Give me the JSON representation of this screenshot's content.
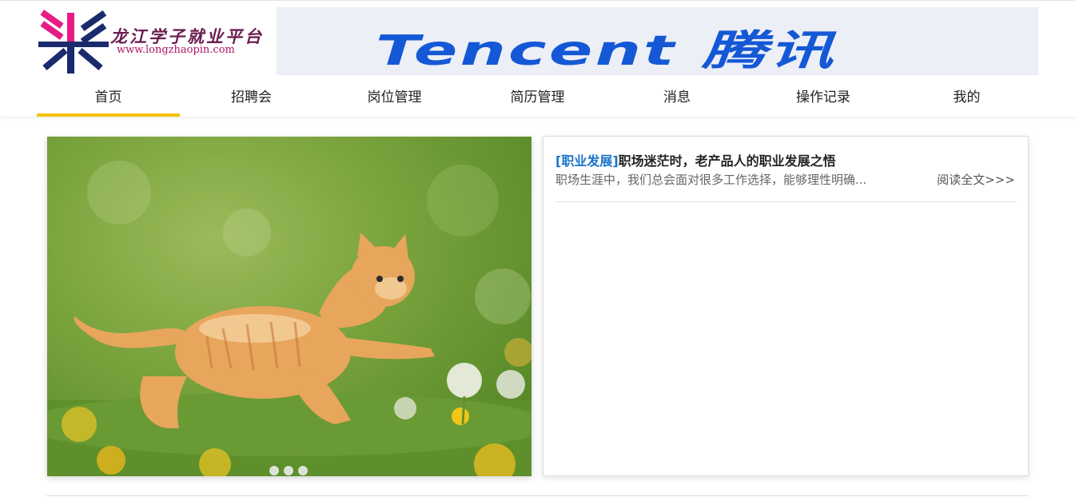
{
  "header": {
    "logo": {
      "title": "龙江学子就业平台",
      "url": "www.longzhaopin.com",
      "mark_colors": [
        "#e51c86",
        "#1a2a6c"
      ]
    },
    "banner": {
      "text": "Tencent 腾讯",
      "color": "#1558d6"
    }
  },
  "nav": {
    "accent_color": "#f6c30b",
    "items": [
      {
        "label": "首页",
        "active": true
      },
      {
        "label": "招聘会",
        "active": false
      },
      {
        "label": "岗位管理",
        "active": false
      },
      {
        "label": "简历管理",
        "active": false
      },
      {
        "label": "消息",
        "active": false
      },
      {
        "label": "操作记录",
        "active": false
      },
      {
        "label": "我的",
        "active": false
      }
    ]
  },
  "carousel": {
    "image": "kitten-in-meadow",
    "slide_count": 3
  },
  "articles": [
    {
      "category": "[职业发展]",
      "title": "职场迷茫时，老产品人的职业发展之悟",
      "summary": "职场生涯中，我们总会面对很多工作选择，能够理性明确...",
      "read_more": "阅读全文>>>"
    }
  ]
}
